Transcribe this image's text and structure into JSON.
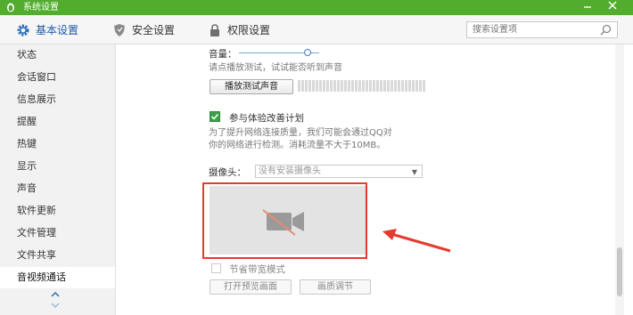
{
  "window": {
    "title": "系统设置"
  },
  "tabs": [
    {
      "label": "基本设置",
      "icon": "gear-icon"
    },
    {
      "label": "安全设置",
      "icon": "shield-icon"
    },
    {
      "label": "权限设置",
      "icon": "lock-icon"
    }
  ],
  "search": {
    "placeholder": "搜索设置项"
  },
  "sidebar": {
    "items": [
      {
        "label": "状态"
      },
      {
        "label": "会话窗口"
      },
      {
        "label": "信息展示"
      },
      {
        "label": "提醒"
      },
      {
        "label": "热键"
      },
      {
        "label": "显示"
      },
      {
        "label": "声音"
      },
      {
        "label": "软件更新"
      },
      {
        "label": "文件管理"
      },
      {
        "label": "文件共享"
      },
      {
        "label": "音视频通话"
      }
    ],
    "active_index": 10
  },
  "main": {
    "volume_label": "音量：",
    "volume_level": 0.85,
    "play_hint": "请点播放测试，试试能否听到声音",
    "play_test_button": "播放测试声音",
    "experience_checkbox": {
      "label": "参与体验改善计划",
      "checked": true
    },
    "experience_desc_line1": "为了提升网络连接质量，我们可能会通过QQ对",
    "experience_desc_line2": "你的网络进行检测。消耗流量不大于10MB。",
    "camera_label": "摄像头：",
    "camera_select_value": "没有安装摄像头",
    "bandwidth_checkbox": {
      "label": "节省带宽模式",
      "checked": false
    },
    "open_preview_button": "打开预览画面",
    "quality_button": "画质调节"
  },
  "colors": {
    "titlebar": "#52ad2f",
    "annotation": "#e53b2e",
    "checkbox_checked": "#3aa146"
  }
}
